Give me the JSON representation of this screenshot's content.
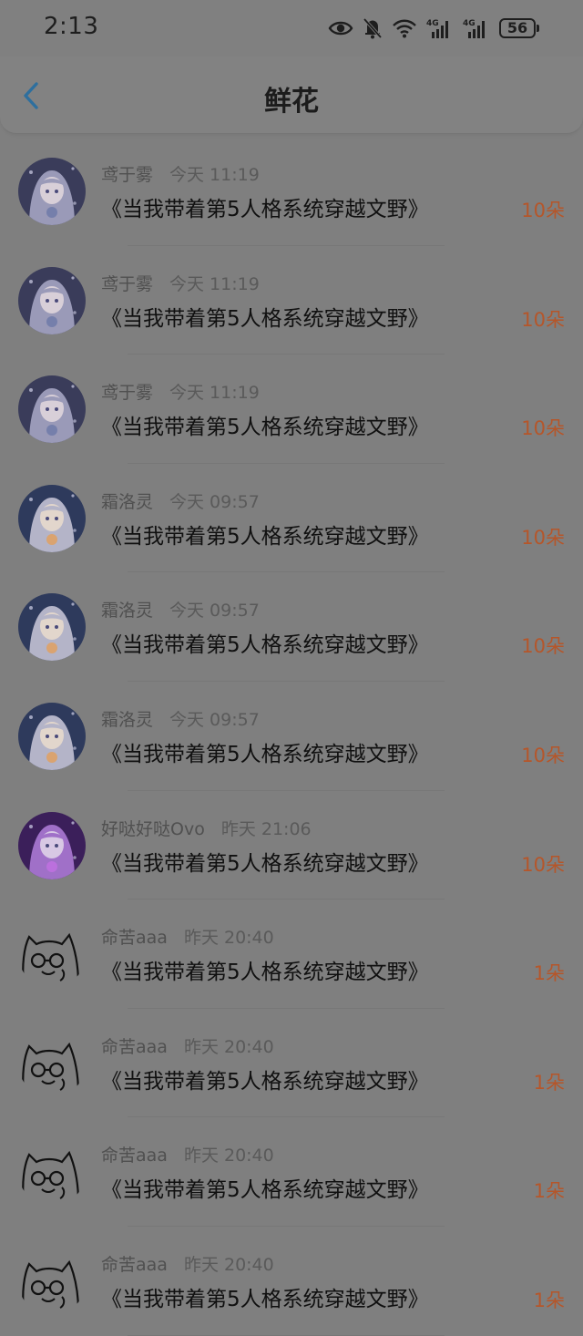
{
  "status": {
    "time": "2:13",
    "battery": "56",
    "network_label_1": "4G",
    "network_label_2": "4G"
  },
  "header": {
    "title": "鲜花"
  },
  "items": [
    {
      "name": "鸢于雾",
      "time": "今天 11:19",
      "book": "《当我带着第5人格系统穿越文野》",
      "count": "10朵",
      "avatar": "anime-girl-blue"
    },
    {
      "name": "鸢于雾",
      "time": "今天 11:19",
      "book": "《当我带着第5人格系统穿越文野》",
      "count": "10朵",
      "avatar": "anime-girl-blue"
    },
    {
      "name": "鸢于雾",
      "time": "今天 11:19",
      "book": "《当我带着第5人格系统穿越文野》",
      "count": "10朵",
      "avatar": "anime-girl-blue"
    },
    {
      "name": "霜洛灵",
      "time": "今天 09:57",
      "book": "《当我带着第5人格系统穿越文野》",
      "count": "10朵",
      "avatar": "anime-girl-heart"
    },
    {
      "name": "霜洛灵",
      "time": "今天 09:57",
      "book": "《当我带着第5人格系统穿越文野》",
      "count": "10朵",
      "avatar": "anime-girl-heart"
    },
    {
      "name": "霜洛灵",
      "time": "今天 09:57",
      "book": "《当我带着第5人格系统穿越文野》",
      "count": "10朵",
      "avatar": "anime-girl-heart"
    },
    {
      "name": "好哒好哒Ovo",
      "time": "昨天 21:06",
      "book": "《当我带着第5人格系统穿越文野》",
      "count": "10朵",
      "avatar": "anime-girl-purple"
    },
    {
      "name": "命苦aaa",
      "time": "昨天 20:40",
      "book": "《当我带着第5人格系统穿越文野》",
      "count": "1朵",
      "avatar": "cat-doodle"
    },
    {
      "name": "命苦aaa",
      "time": "昨天 20:40",
      "book": "《当我带着第5人格系统穿越文野》",
      "count": "1朵",
      "avatar": "cat-doodle"
    },
    {
      "name": "命苦aaa",
      "time": "昨天 20:40",
      "book": "《当我带着第5人格系统穿越文野》",
      "count": "1朵",
      "avatar": "cat-doodle"
    },
    {
      "name": "命苦aaa",
      "time": "昨天 20:40",
      "book": "《当我带着第5人格系统穿越文野》",
      "count": "1朵",
      "avatar": "cat-doodle"
    }
  ],
  "colors": {
    "background": "#7f7f7f",
    "count": "#b5562a",
    "back_arrow": "#2e6f9e"
  }
}
